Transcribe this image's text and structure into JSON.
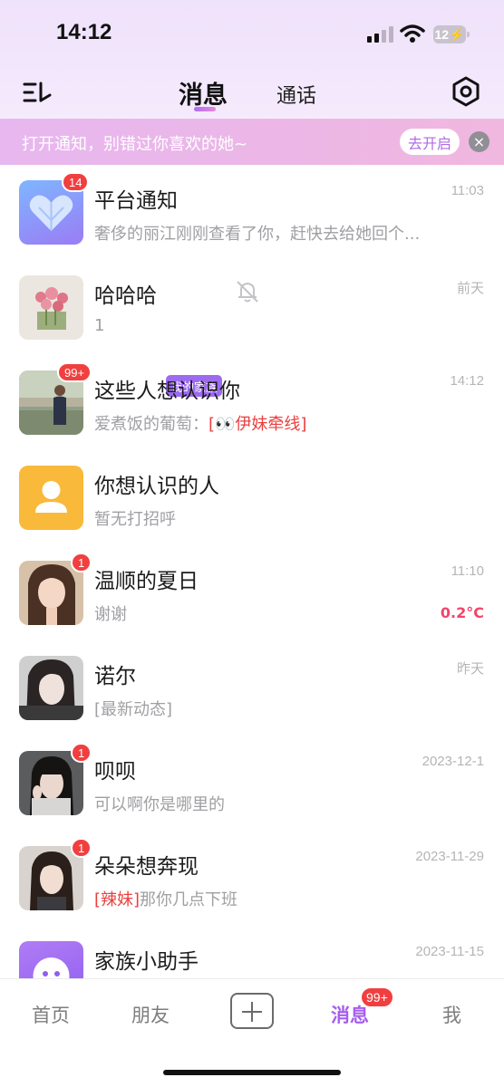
{
  "status_bar": {
    "time": "14:12",
    "battery": "12"
  },
  "header": {
    "tab_active": "消息",
    "tab_inactive": "通话"
  },
  "notify_banner": {
    "text": "打开通知，别错过你喜欢的她~",
    "button_label": "去开启",
    "close_label": "×"
  },
  "conversations": [
    {
      "name": "平台通知",
      "time": "11:03",
      "preview": "奢侈的丽江刚刚查看了你，赶快去给她回个...",
      "badge": "14",
      "avatar": "heart-icon"
    },
    {
      "name": "哈哈哈",
      "tag": "我的家族",
      "time": "前天",
      "preview": "1",
      "muted": true,
      "avatar": "flowers-photo"
    },
    {
      "name": "这些人想认识你",
      "time": "14:12",
      "preview_prefix": "爱煮饭的葡萄：",
      "preview_highlight": "[👀伊妹牵线]",
      "badge": "99+",
      "avatar": "man-photo"
    },
    {
      "name": "你想认识的人",
      "time": "",
      "preview": "暂无打招呼",
      "avatar": "person-icon"
    },
    {
      "name": "温顺的夏日",
      "time": "11:10",
      "preview": "谢谢",
      "badge": "1",
      "temperature": "0.2°C",
      "avatar": "girl-photo-1"
    },
    {
      "name": "诺尔",
      "time": "昨天",
      "preview": "[最新动态]",
      "avatar": "girl-photo-2"
    },
    {
      "name": "呗呗",
      "time": "2023-12-1",
      "preview": "可以啊你是哪里的",
      "badge": "1",
      "avatar": "girl-photo-3"
    },
    {
      "name": "朵朵想奔现",
      "time": "2023-11-29",
      "preview_highlight": "[辣妹]",
      "preview": "那你几点下班",
      "badge": "1",
      "avatar": "girl-photo-4"
    },
    {
      "name": "家族小助手",
      "time": "2023-11-15",
      "preview": "",
      "avatar": "assistant-icon"
    }
  ],
  "bottom_nav": {
    "items": [
      "首页",
      "朋友",
      "消息",
      "我"
    ],
    "active": "消息",
    "badge": "99+"
  },
  "colors": {
    "accent": "#a55ef0",
    "badge": "#f13f3f",
    "banner": "#eab6e8"
  }
}
